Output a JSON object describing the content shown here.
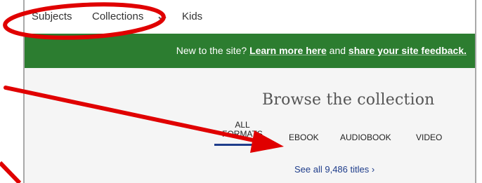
{
  "nav": {
    "subjects": "Subjects",
    "collections": "Collections",
    "kids": "Kids"
  },
  "banner": {
    "prefix": "New to the site? ",
    "learn_more": "Learn more here",
    "middle": " and ",
    "feedback": "share your site feedback."
  },
  "browse": {
    "title": "Browse the collection",
    "tabs": {
      "all_line1": "ALL",
      "all_line2": "FORMATS",
      "ebook": "EBOOK",
      "audiobook": "AUDIOBOOK",
      "video": "VIDEO"
    },
    "see_all": "See all 9,486 titles ›"
  },
  "colors": {
    "banner_bg": "#2c7d30",
    "annotation": "#e00000",
    "active_tab": "#1f3d8b"
  }
}
